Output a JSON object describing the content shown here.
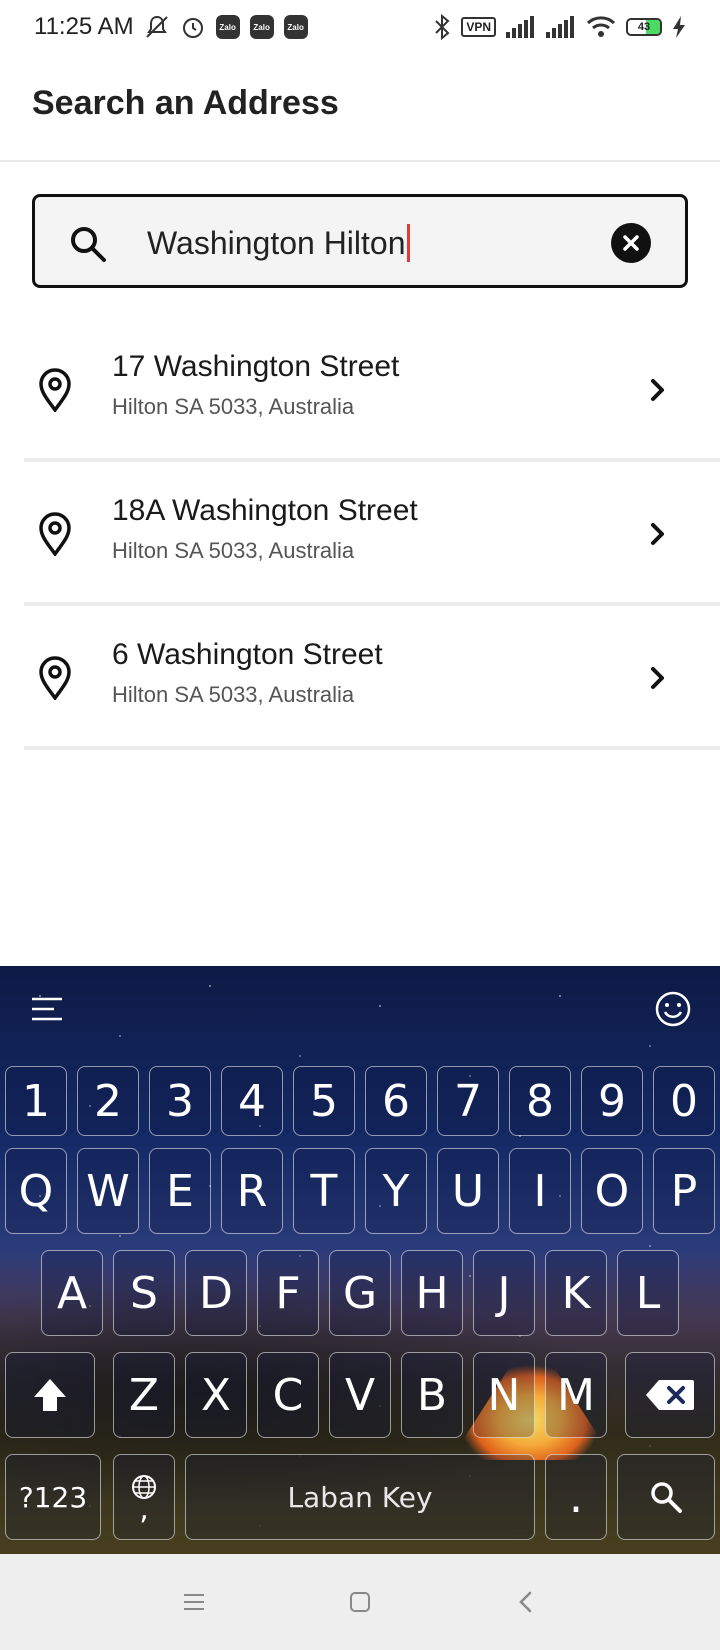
{
  "status_bar": {
    "time": "11:25 AM",
    "zalo_labels": [
      "Zalo",
      "Zalo",
      "Zalo"
    ],
    "vpn": "VPN",
    "battery": "43",
    "icons": [
      "mute-icon",
      "alarm-icon",
      "bluetooth-icon",
      "signal-icon",
      "wifi-icon",
      "battery-icon",
      "charging-icon"
    ]
  },
  "header": {
    "title": "Search an Address"
  },
  "search": {
    "value": "Washington Hilton"
  },
  "results": [
    {
      "title": "17 Washington Street",
      "subtitle": "Hilton SA 5033, Australia"
    },
    {
      "title": "18A Washington Street",
      "subtitle": "Hilton SA 5033, Australia"
    },
    {
      "title": "6 Washington Street",
      "subtitle": "Hilton SA 5033, Australia"
    }
  ],
  "keyboard": {
    "number_row": [
      "1",
      "2",
      "3",
      "4",
      "5",
      "6",
      "7",
      "8",
      "9",
      "0"
    ],
    "row1": [
      "Q",
      "W",
      "E",
      "R",
      "T",
      "Y",
      "U",
      "I",
      "O",
      "P"
    ],
    "row2": [
      "A",
      "S",
      "D",
      "F",
      "G",
      "H",
      "J",
      "K",
      "L"
    ],
    "row3": [
      "Z",
      "X",
      "C",
      "V",
      "B",
      "N",
      "M"
    ],
    "symbols_key": "?123",
    "comma_key": ",",
    "space_label": "Laban Key",
    "period_key": "."
  },
  "colors": {
    "caret": "#e53935",
    "accent": "#111111",
    "keyboard_sky": "#152a66"
  }
}
